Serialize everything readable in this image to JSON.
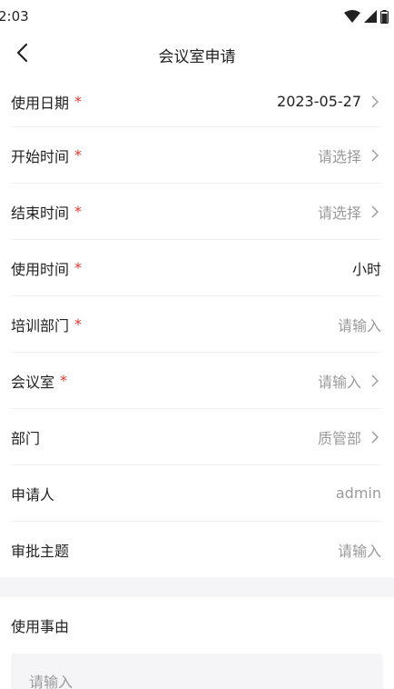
{
  "status_bar": {
    "time": "2:03"
  },
  "nav": {
    "title": "会议室申请"
  },
  "form": {
    "rows": [
      {
        "label": "使用日期",
        "required": true,
        "value": "2023-05-27"
      },
      {
        "label": "开始时间",
        "required": true,
        "value": "请选择"
      },
      {
        "label": "结束时间",
        "required": true,
        "value": "请选择"
      },
      {
        "label": "使用时间",
        "required": true,
        "value": "小时"
      },
      {
        "label": "培训部门",
        "required": true,
        "value": "请输入"
      },
      {
        "label": "会议室",
        "required": true,
        "value": "请输入"
      },
      {
        "label": "部门",
        "required": false,
        "value": "质管部"
      },
      {
        "label": "申请人",
        "required": false,
        "value": "admin"
      },
      {
        "label": "审批主题",
        "required": false,
        "value": "请输入"
      }
    ],
    "required_mark": "*"
  },
  "reason": {
    "label": "使用事由",
    "placeholder": "请输入"
  },
  "colors": {
    "required": "#e2362f",
    "placeholder": "#9a9a9a",
    "text": "#222222",
    "section_bg": "#f5f5f7"
  }
}
